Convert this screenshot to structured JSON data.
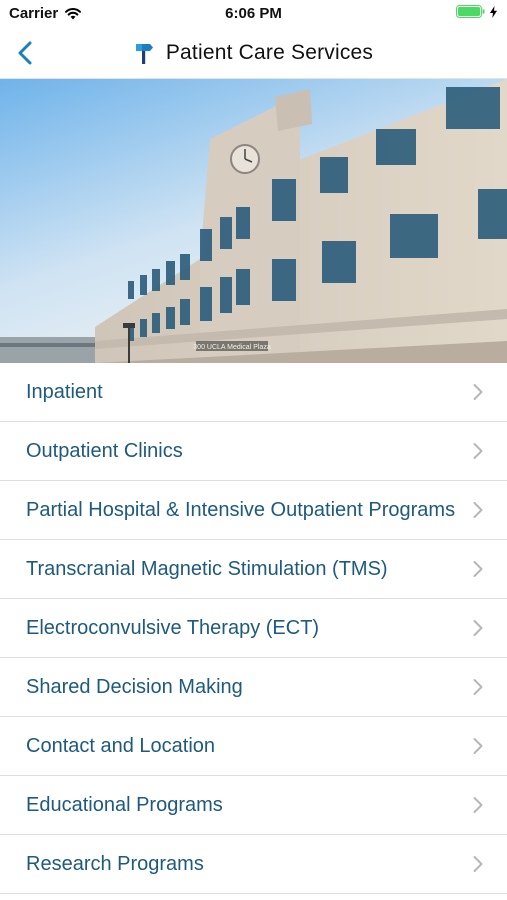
{
  "status_bar": {
    "carrier": "Carrier",
    "time": "6:06 PM",
    "battery_color": "#4cd964"
  },
  "nav": {
    "title": "Patient Care Services",
    "accent_color": "#1a7fc1",
    "back_icon": "chevron-left-icon",
    "logo_icon": "signpost-logo-icon"
  },
  "hero": {
    "building_sign": "300 UCLA Medical Plaza"
  },
  "menu": {
    "items": [
      {
        "label": "Inpatient"
      },
      {
        "label": "Outpatient Clinics"
      },
      {
        "label": "Partial Hospital & Intensive Outpatient Programs"
      },
      {
        "label": "Transcranial Magnetic Stimulation (TMS)"
      },
      {
        "label": "Electroconvulsive Therapy (ECT)"
      },
      {
        "label": "Shared Decision Making"
      },
      {
        "label": "Contact and Location"
      },
      {
        "label": "Educational Programs"
      },
      {
        "label": "Research Programs"
      }
    ],
    "label_color": "#1d5a7d",
    "chevron_icon": "chevron-right-icon"
  }
}
